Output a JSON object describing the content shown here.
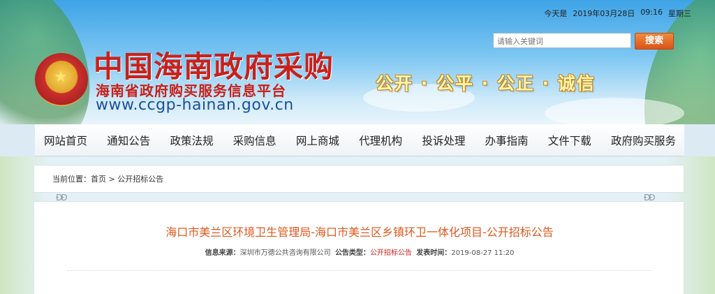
{
  "header": {
    "date_label": "今天是",
    "date_value": "2019年03月28日",
    "time_value": "09:16",
    "weekday": "星期三",
    "search": {
      "placeholder": "请输入关键词",
      "button_label": "搜索"
    },
    "site_title": "中国海南政府采购",
    "site_subtitle": "海南省政府购买服务信息平台",
    "site_url": "www.ccgp-hainan.gov.cn",
    "slogan": "公开 · 公平 · 公正 · 诚信"
  },
  "nav": {
    "items": [
      {
        "label": "网站首页"
      },
      {
        "label": "通知公告"
      },
      {
        "label": "政策法规"
      },
      {
        "label": "采购信息"
      },
      {
        "label": "网上商城"
      },
      {
        "label": "代理机构"
      },
      {
        "label": "投诉处理"
      },
      {
        "label": "办事指南"
      },
      {
        "label": "文件下载"
      },
      {
        "label": "政府购买服务"
      }
    ]
  },
  "breadcrumb": {
    "prefix": "当前位置：",
    "home": "首页",
    "separator": ">",
    "current": "公开招标公告"
  },
  "article": {
    "title": "海口市美兰区环境卫生管理局-海口市美兰区乡镇环卫一体化项目-公开招标公告",
    "source_label": "信息来源：",
    "source_value": "深圳市万德公共咨询有限公司",
    "type_label": "公告类型：",
    "type_value": "公开招标公告",
    "date_label": "发表时间：",
    "date_value": "2019-08-27 11:20"
  },
  "colors": {
    "brand_red": "#c9201a",
    "accent_orange": "#e0591e",
    "url_blue": "#1c4f98"
  }
}
